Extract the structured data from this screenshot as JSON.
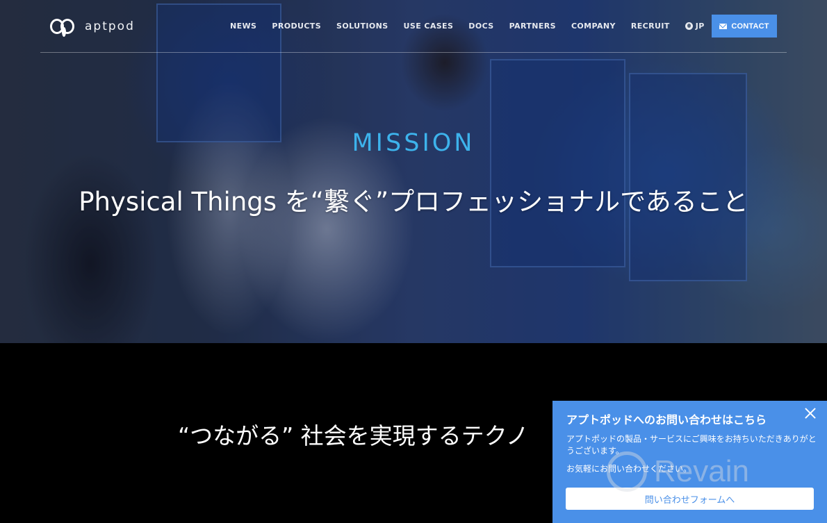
{
  "header": {
    "logo_text": "aptpod",
    "nav": [
      {
        "label": "NEWS"
      },
      {
        "label": "PRODUCTS"
      },
      {
        "label": "SOLUTIONS"
      },
      {
        "label": "USE CASES"
      },
      {
        "label": "DOCS"
      },
      {
        "label": "PARTNERS"
      },
      {
        "label": "COMPANY"
      },
      {
        "label": "RECRUIT"
      }
    ],
    "language": {
      "icon": "globe-icon",
      "label": "JP"
    },
    "contact": {
      "icon": "mail-icon",
      "label": "CONTACT"
    }
  },
  "hero": {
    "eyebrow": "MISSION",
    "headline": "Physical Things を“繋ぐ”プロフェッショナルであること"
  },
  "section": {
    "tagline": "“つながる” 社会を実現するテクノ"
  },
  "chat_widget": {
    "title": "アプトポッドへのお問い合わせはこちら",
    "body": [
      "アプトポッドの製品・サービスにご興味をお持ちいただきありがとうございます。",
      "お気軽にお問い合わせください。"
    ],
    "cta_label": "問い合わせフォームへ",
    "close_icon": "close-icon"
  },
  "watermark": {
    "text": "Revain"
  },
  "colors": {
    "accent": "#4a90e8",
    "mission": "#3db3ec",
    "background": "#000000"
  }
}
